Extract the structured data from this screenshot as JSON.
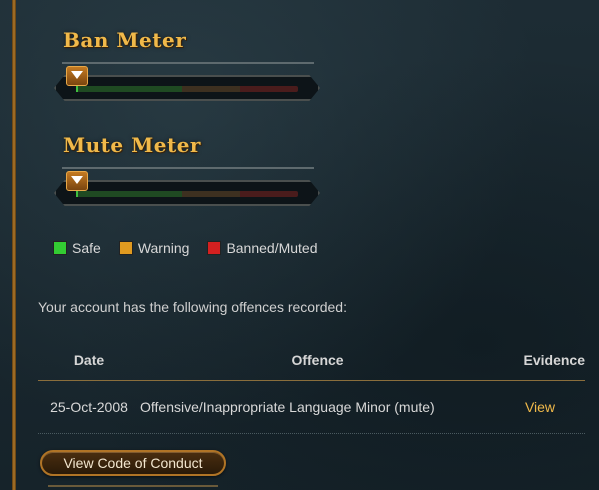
{
  "ban_meter": {
    "title": "Ban Meter",
    "level": 0.0
  },
  "mute_meter": {
    "title": "Mute Meter",
    "level": 0.0
  },
  "legend": [
    {
      "label": "Safe",
      "color": "#33cc33"
    },
    {
      "label": "Warning",
      "color": "#e09a20"
    },
    {
      "label": "Banned/Muted",
      "color": "#d42020"
    }
  ],
  "intro": "Your account has the following offences recorded:",
  "table": {
    "headers": {
      "date": "Date",
      "offence": "Offence",
      "evidence": "Evidence"
    },
    "rows": [
      {
        "date": "25-Oct-2008",
        "offence": "Offensive/Inappropriate Language Minor (mute)",
        "evidence": "View"
      }
    ]
  },
  "code_button": "View Code of Conduct",
  "colors": {
    "accent": "#f0b94a",
    "background": "#1a2830"
  }
}
